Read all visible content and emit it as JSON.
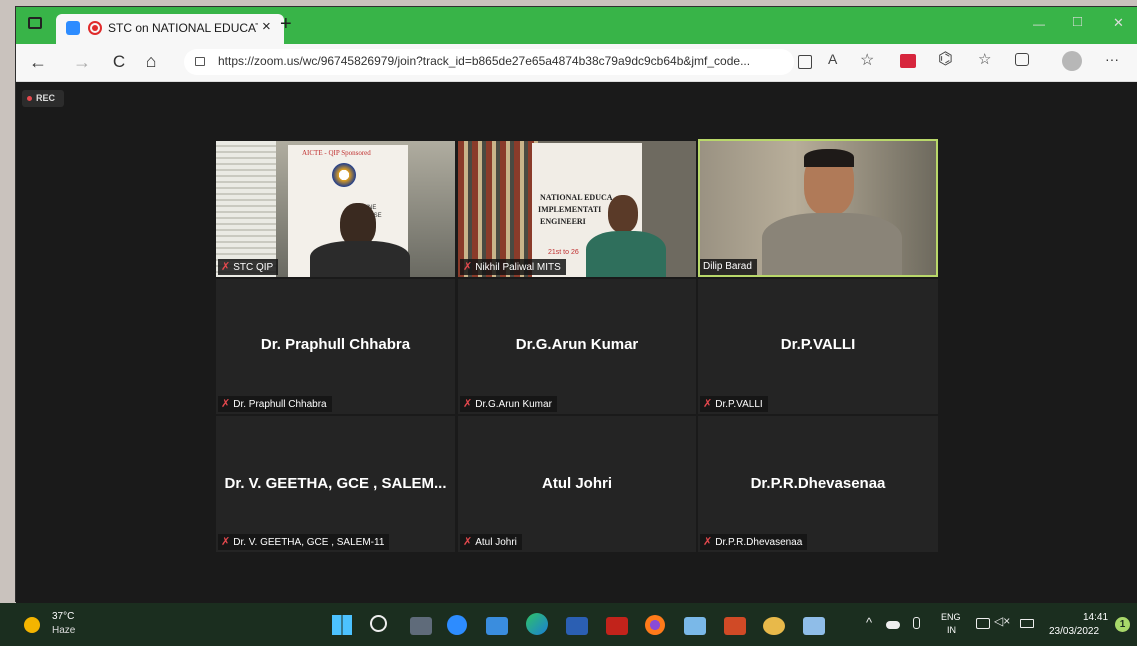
{
  "browser": {
    "tab_title": "STC on NATIONAL EDUCATI",
    "tab_close": "×",
    "new_tab": "+",
    "url": "https://zoom.us/wc/96745826979/join?track_id=b865de27e65a4874b38c79a9dc9cb64b&jmf_code...",
    "lock_glyph": "🔒",
    "min_glyph": "—",
    "max_glyph": "□",
    "close_glyph": "✕",
    "back_glyph": "←",
    "forward_glyph": "→",
    "refresh_glyph": "C",
    "home_glyph": "⌂",
    "more_glyph": "···",
    "read_aloud": "A͡"
  },
  "zoom": {
    "rec_label": "REC",
    "video_tiles": [
      {
        "name": "STC QIP"
      },
      {
        "name": "Nikhil Paliwal MITS"
      },
      {
        "name": "Dilip Barad"
      }
    ],
    "name_tiles": [
      {
        "display": "Dr. Praphull Chhabra",
        "caption": "Dr. Praphull Chhabra"
      },
      {
        "display": "Dr.G.Arun Kumar",
        "caption": "Dr.G.Arun Kumar"
      },
      {
        "display": "Dr.P.VALLI",
        "caption": "Dr.P.VALLI"
      },
      {
        "display": "Dr. V. GEETHA, GCE , SALEM...",
        "caption": "Dr. V. GEETHA, GCE , SALEM-11"
      },
      {
        "display": "Atul Johri",
        "caption": "Atul Johri"
      },
      {
        "display": "Dr.P.R.Dhevasenaa",
        "caption": "Dr.P.R.Dhevasenaa"
      }
    ],
    "banner_lines": [
      "AICTE - QIP Sponsored",
      "ONLINE",
      "COURSE",
      "NATIONAL EDUCA",
      "IMPLEMENTATI",
      "ENGINEERI",
      "INSTIT",
      "21st to 26"
    ]
  },
  "taskbar": {
    "weather_temp": "37°C",
    "weather_desc": "Haze",
    "lang_top": "ENG",
    "lang_bottom": "IN",
    "time": "14:41",
    "date": "23/03/2022",
    "notif_count": "1",
    "tray_up": "^"
  },
  "colors": {
    "tab_bar": "#38b448",
    "active_speaker": "#b9d86a",
    "mute_red": "#e5484d"
  }
}
